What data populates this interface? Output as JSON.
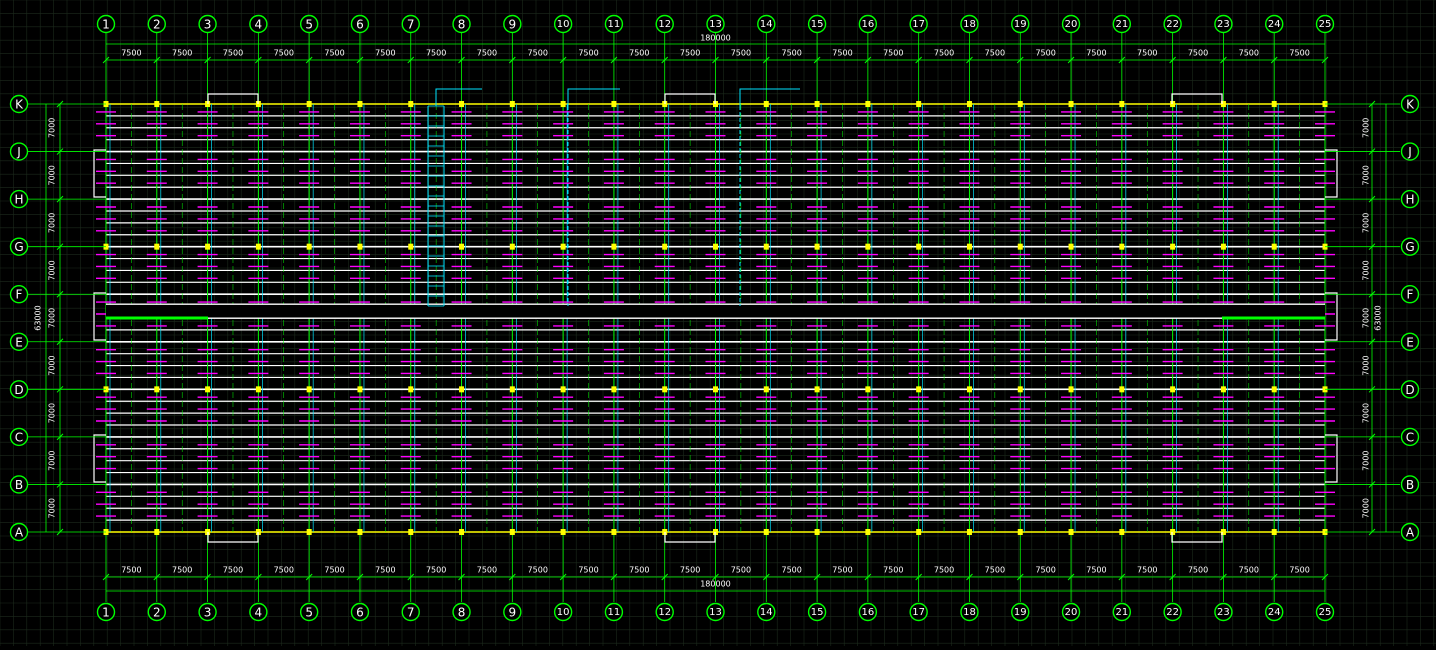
{
  "column_labels": [
    "1",
    "2",
    "3",
    "4",
    "5",
    "6",
    "7",
    "8",
    "9",
    "10",
    "11",
    "12",
    "13",
    "14",
    "15",
    "16",
    "17",
    "18",
    "19",
    "20",
    "21",
    "22",
    "23",
    "24",
    "25"
  ],
  "row_labels": [
    "K",
    "J",
    "H",
    "G",
    "F",
    "E",
    "D",
    "C",
    "B",
    "A"
  ],
  "bay_dim": "7500",
  "row_dim": "7000",
  "total_length": "180000",
  "total_width": "63000",
  "colors": {
    "background": "#000000",
    "grid": "#1c2a1c",
    "axis": "#00ff00",
    "bubble": "#00ff00",
    "beam": "#ffffff",
    "purlin": "#ff00ff",
    "brace": "#00e5ff",
    "column": "#ffff00",
    "edge": "#ffff00",
    "dim": "#00ff00",
    "text": "#ffffff"
  }
}
